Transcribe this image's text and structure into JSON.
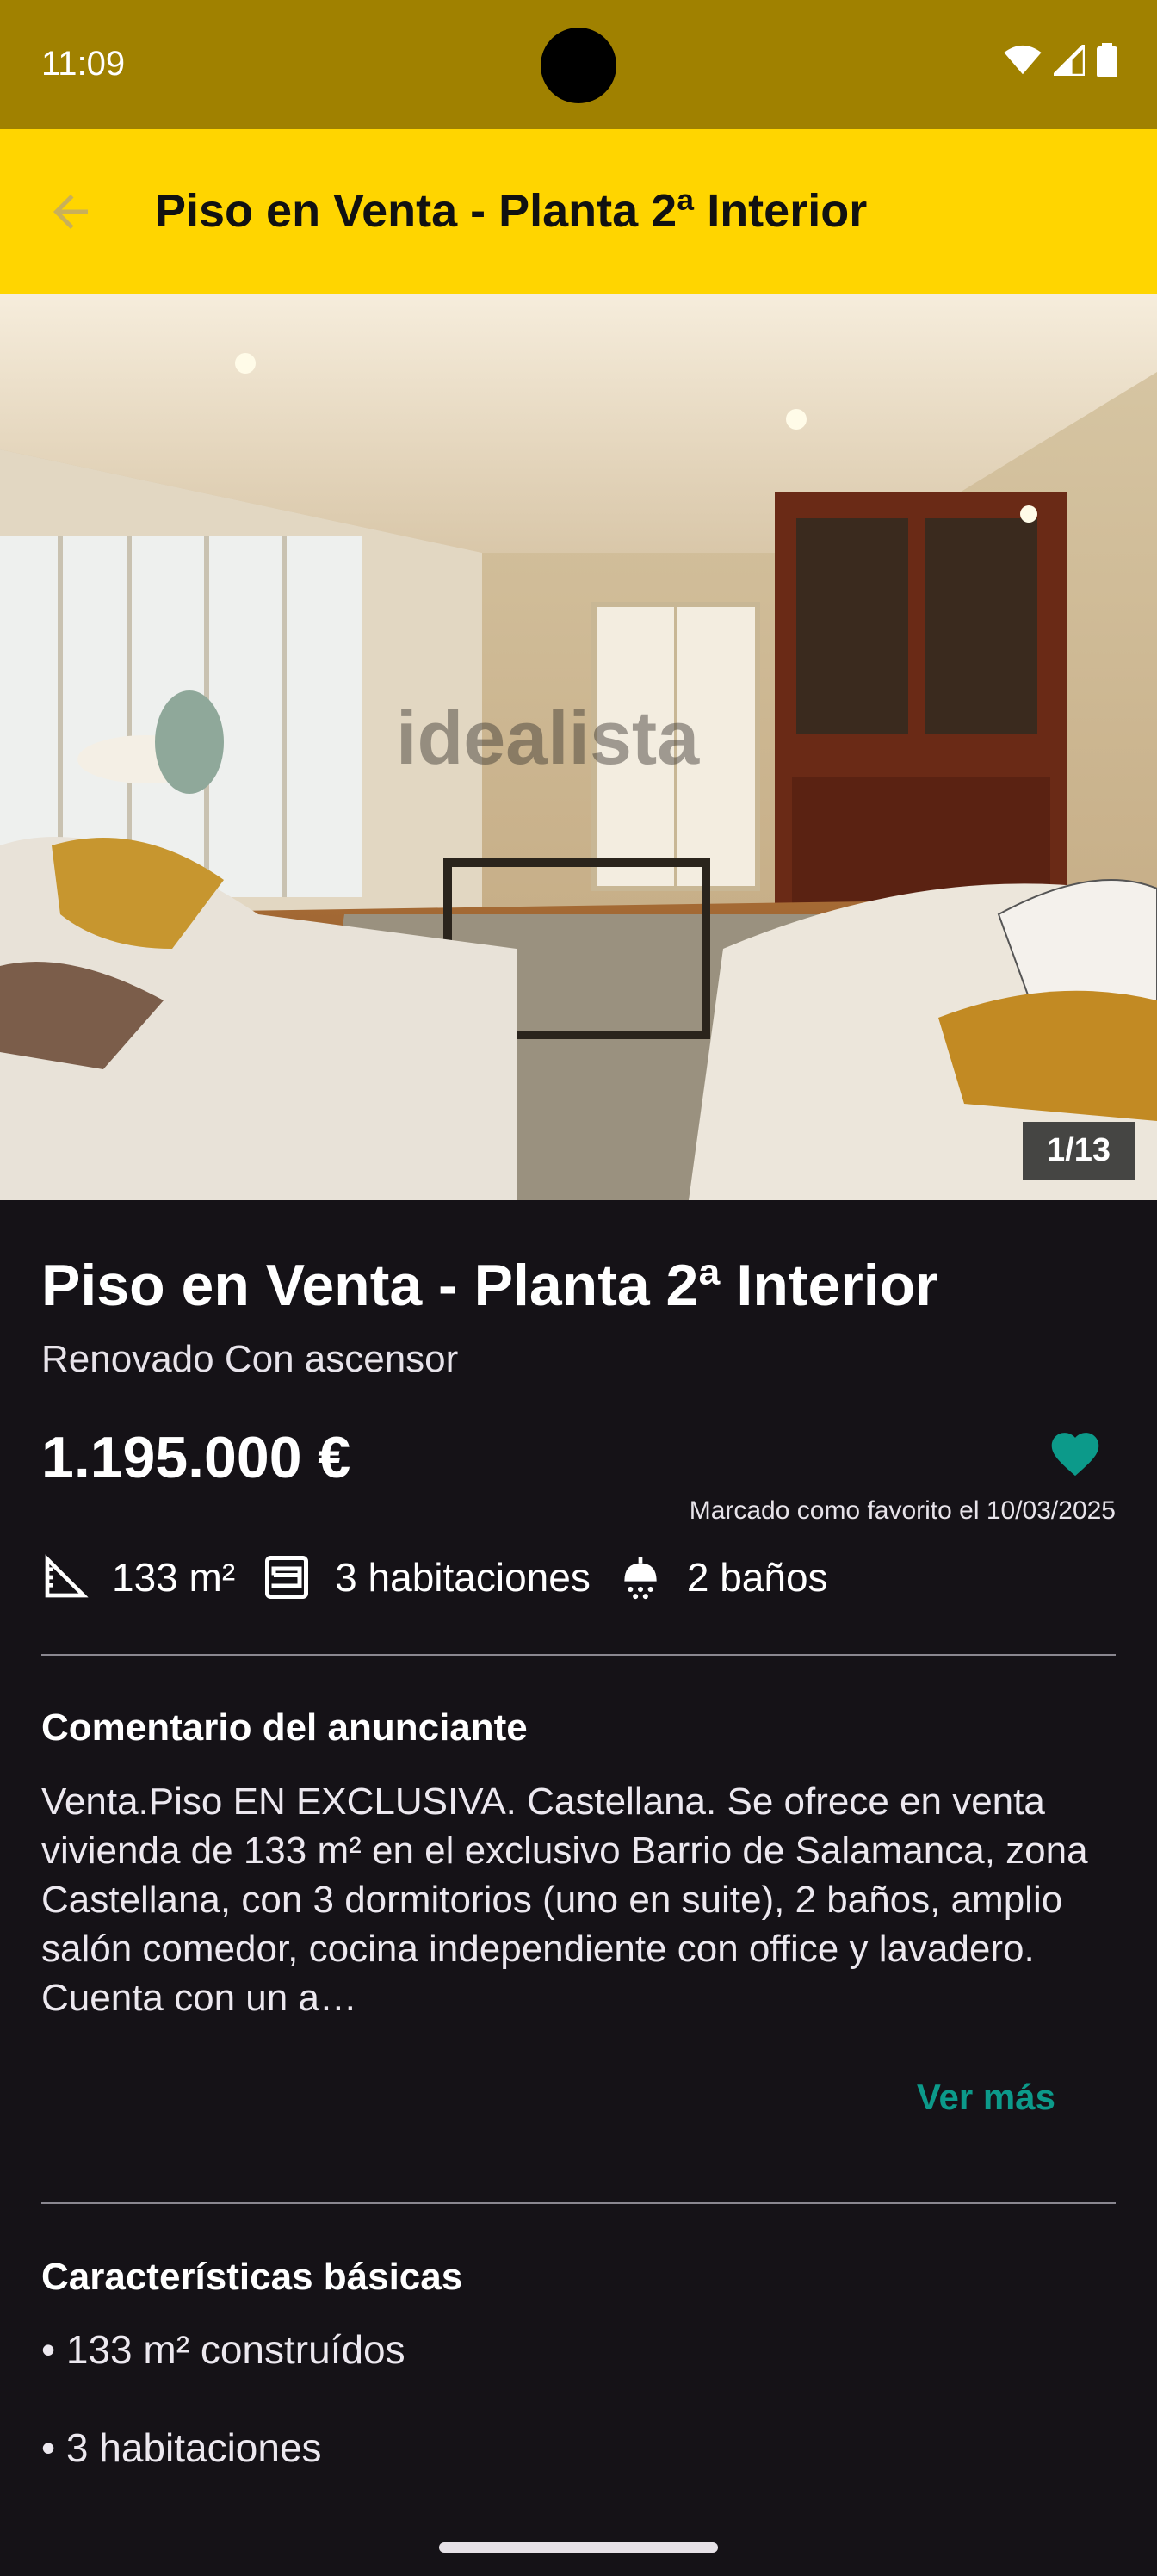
{
  "status": {
    "time": "11:09"
  },
  "appbar": {
    "title": "Piso en Venta - Planta 2ª Interior"
  },
  "gallery": {
    "counter": "1/13",
    "watermark": "idealista"
  },
  "listing": {
    "title": "Piso en Venta - Planta 2ª Interior",
    "subtitle": "Renovado Con ascensor",
    "price": "1.195.000 €",
    "favorite_note": "Marcado como favorito el 10/03/2025",
    "area": "133 m²",
    "rooms": "3 habitaciones",
    "baths": "2 baños"
  },
  "comment": {
    "title": "Comentario del anunciante",
    "text": "Venta.Piso EN EXCLUSIVA. Castellana. Se ofrece en venta vivienda de 133 m² en el exclusivo Barrio de Salamanca, zona Castellana, con 3 dormitorios (uno en suite), 2 baños, amplio salón comedor, cocina independiente con office y lavadero. Cuenta con un a…",
    "more_label": "Ver más"
  },
  "basics": {
    "title": "Características básicas",
    "items": [
      "• 133 m² construídos",
      "• 3 habitaciones"
    ]
  },
  "colors": {
    "accent": "#ffd500",
    "favorite": "#0c9a8a",
    "background": "#151217"
  }
}
